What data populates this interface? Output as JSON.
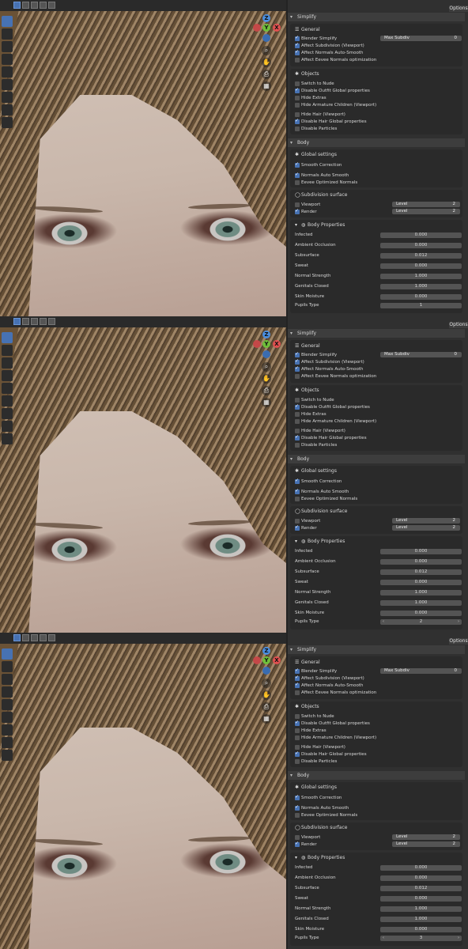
{
  "viewport": {
    "toolbar_icons": [
      "select-box-icon",
      "cursor-icon",
      "move-icon",
      "rotate-icon",
      "scale-icon",
      "transform-icon",
      "annotate-icon",
      "measure-icon",
      "add-cube-icon"
    ],
    "gizmo": {
      "axis_x": "X",
      "axis_y": "Y",
      "axis_z": "Z"
    },
    "nav_icons": [
      "zoom-icon",
      "pan-icon",
      "camera-icon",
      "grid-icon"
    ]
  },
  "panel": {
    "options_label": "Options",
    "simplify_title": "Simplify",
    "general": {
      "title": "General",
      "blender_simplify": "Blender Simplify",
      "max_subdiv_label": "Max Subdiv",
      "max_subdiv_value": "0",
      "affect_subdivision": "Affect Subdivision (Viewport)",
      "affect_normals": "Affect Normals Auto-Smooth",
      "affect_eevee": "Affect Eevee Normals optimization"
    },
    "objects": {
      "title": "Objects",
      "switch_to_nude": "Switch to Nude",
      "disable_outfit": "Disable Outfit Global properties",
      "hide_extras": "Hide Extras",
      "hide_armature": "Hide Armature Children (Viewport)",
      "hide_hair": "Hide Hair (Viewport)",
      "disable_hair": "Disable Hair Global properties",
      "disable_particles": "Disable Particles"
    },
    "body_title": "Body",
    "global_settings": {
      "title": "Global settings",
      "smooth_correction": "Smooth Correction",
      "normals_auto_smooth": "Normals Auto Smooth",
      "eevee_optimized": "Eevee Optimized Normals"
    },
    "subdivision": {
      "title": "Subdivision surface",
      "viewport": "Viewport",
      "render": "Render",
      "level_label": "Level",
      "viewport_level": "2",
      "render_level": "2"
    },
    "body_properties": {
      "title": "Body Properties",
      "items": [
        {
          "label": "Infected",
          "value": "0.000"
        },
        {
          "label": "Ambient Occlusion",
          "value": "0.000"
        },
        {
          "label": "Subsurface",
          "value": "0.012"
        },
        {
          "label": "Sweat",
          "value": "0.000"
        },
        {
          "label": "Normal Strength",
          "value": "1.000"
        },
        {
          "label": "Genitals Closed",
          "value": "1.000"
        },
        {
          "label": "Skin Moisture",
          "value": "0.000"
        }
      ],
      "pupils_label": "Pupils Type"
    }
  },
  "frames": [
    {
      "pupils_value": "1"
    },
    {
      "pupils_value": "2"
    },
    {
      "pupils_value": "3"
    }
  ],
  "colors": {
    "accent": "#4772b3",
    "panel_bg": "#303030",
    "field_bg": "#545454"
  }
}
